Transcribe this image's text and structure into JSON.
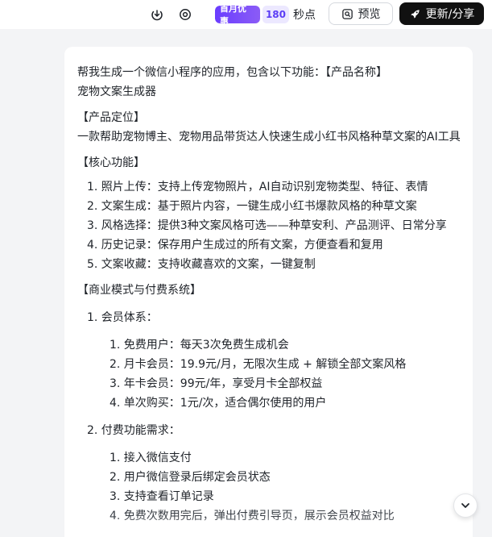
{
  "toolbar": {
    "download_icon": "download-icon",
    "settings_icon": "target-icon",
    "promo": {
      "badge": "首月优惠",
      "count": "180",
      "unit": "秒点"
    },
    "preview_label": "预览",
    "update_label": "更新/分享",
    "accent_color": "#6a3cff"
  },
  "message": {
    "intro": "帮我生成一个微信小程序的应用，包含以下功能：【产品名称】",
    "product_name": "宠物文案生成器",
    "positioning_heading": "【产品定位】",
    "positioning_text": "一款帮助宠物博主、宠物用品带货达人快速生成小红书风格种草文案的AI工具",
    "features_heading": "【核心功能】",
    "features": [
      "1. 照片上传：支持上传宠物照片，AI自动识别宠物类型、特征、表情",
      "2. 文案生成：基于照片内容，一键生成小红书爆款风格的种草文案",
      "3. 风格选择：提供3种文案风格可选——种草安利、产品测评、日常分享",
      "4. 历史记录：保存用户生成过的所有文案，方便查看和复用",
      "5. 文案收藏：支持收藏喜欢的文案，一键复制"
    ],
    "business_heading": "【商业模式与付费系统】",
    "membership_heading": "1. 会员体系：",
    "membership": [
      "1. 免费用户：每天3次免费生成机会",
      "2. 月卡会员：19.9元/月，无限次生成 + 解锁全部文案风格",
      "3. 年卡会员：99元/年，享受月卡全部权益",
      "4. 单次购买：1元/次，适合偶尔使用的用户"
    ],
    "payment_heading": "2. 付费功能需求：",
    "payment": [
      "1. 接入微信支付",
      "2. 用户微信登录后绑定会员状态",
      "3. 支持查看订单记录",
      "4. 免费次数用完后，弹出付费引导页，展示会员权益对比"
    ]
  },
  "scroll_icon": "chevron-down-icon"
}
